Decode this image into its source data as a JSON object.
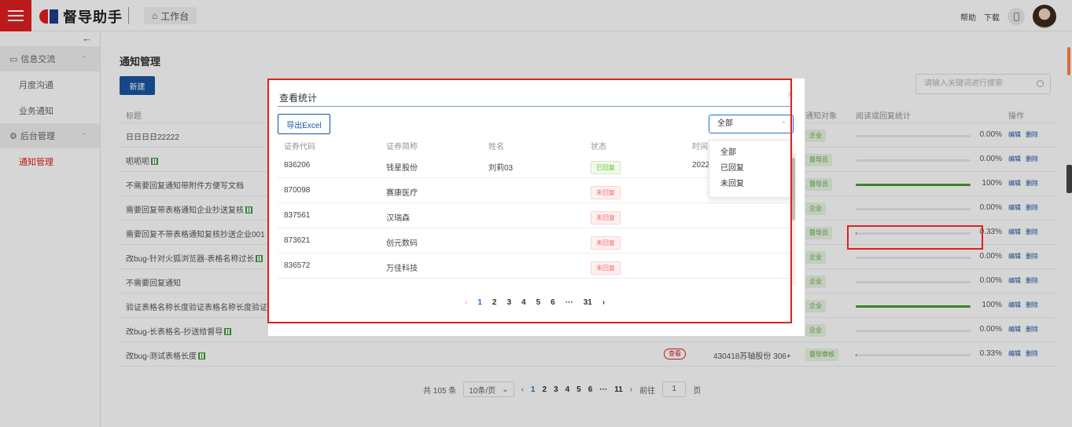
{
  "header": {
    "logo_text": "督导助手",
    "workbench_label": "工作台",
    "help_label": "帮助",
    "download_label": "下载"
  },
  "sidebar": {
    "collapse_icon": "←",
    "groups": [
      {
        "label": "信息交流",
        "items": [
          "月度沟通",
          "业务通知"
        ]
      },
      {
        "label": "后台管理",
        "items": [
          "通知管理"
        ]
      }
    ]
  },
  "main": {
    "title": "通知管理",
    "new_button": "新建",
    "search_placeholder": "请输入关键词进行搜索",
    "columns": {
      "title": "标题",
      "target": "通知对象",
      "stats": "阅读或回复统计",
      "ops": "操作"
    },
    "op_edit": "编辑",
    "op_delete": "删除",
    "rows": [
      {
        "title": "日日日日22222",
        "target": "企业",
        "pct": "0.00%",
        "fill": 0
      },
      {
        "title": "呃呃呃",
        "icon": true,
        "target": "督导员",
        "pct": "0.00%",
        "fill": 0
      },
      {
        "title": "不需要回复通知带附件方便写文档",
        "target": "督导员",
        "pct": "100%",
        "fill": 1
      },
      {
        "title": "需要回复带表格通知企业抄送复核",
        "icon": true,
        "target": "企业",
        "pct": "0.00%",
        "fill": 0
      },
      {
        "title": "需要回复不带表格通知复核抄送企业001",
        "target": "督导员",
        "pct": "0.33%",
        "fill": 0.0033
      },
      {
        "title": "改bug-针对火狐浏览器-表格名称过长",
        "icon": true,
        "target": "企业",
        "pct": "0.00%",
        "fill": 0
      },
      {
        "title": "不需要回复通知",
        "target": "企业",
        "pct": "0.00%",
        "fill": 0
      },
      {
        "title": "验证表格名称长度验证表格名称长度验证表格",
        "target": "企业",
        "pct": "100%",
        "fill": 1
      },
      {
        "title": "改bug-长表格名-抄送给督导",
        "icon": true,
        "target": "企业",
        "pct": "0.00%",
        "fill": 0
      },
      {
        "title": "改bug-测试表格长度",
        "icon": true,
        "type_badge": "查看",
        "company": "430418苏轴股份 306+",
        "target": "督导审核",
        "pct": "0.33%",
        "fill": 0.0033
      }
    ],
    "pager": {
      "total": "共 105 条",
      "page_size": "10条/页",
      "pages": [
        "1",
        "2",
        "3",
        "4",
        "5",
        "6",
        "···",
        "11"
      ],
      "goto_label": "前往",
      "goto_value": "1",
      "page_unit": "页"
    }
  },
  "modal": {
    "title": "查看统计",
    "export_button": "导出Excel",
    "filter_value": "全部",
    "filter_options": [
      "全部",
      "已回复",
      "未回复"
    ],
    "columns": {
      "code": "证券代码",
      "name": "证券简称",
      "person": "姓名",
      "status": "状态",
      "time": "时间"
    },
    "rows": [
      {
        "code": "836206",
        "name": "钱星股份",
        "person": "刘莉03",
        "status": "已回复",
        "time": "2022"
      },
      {
        "code": "870098",
        "name": "赛康医疗",
        "person": "",
        "status": "未回复",
        "time": ""
      },
      {
        "code": "837561",
        "name": "汉瑞森",
        "person": "",
        "status": "未回复",
        "time": ""
      },
      {
        "code": "873621",
        "name": "创元数码",
        "person": "",
        "status": "未回复",
        "time": ""
      },
      {
        "code": "836572",
        "name": "万佳科技",
        "person": "",
        "status": "未回复",
        "time": ""
      }
    ],
    "pager": {
      "prev": "‹",
      "pages": [
        "1",
        "2",
        "3",
        "4",
        "5",
        "6",
        "···",
        "31"
      ],
      "next": "›"
    }
  },
  "colors": {
    "brand_red": "#e0201f",
    "brand_blue": "#1a55a3",
    "progress_green": "#43a02b"
  }
}
